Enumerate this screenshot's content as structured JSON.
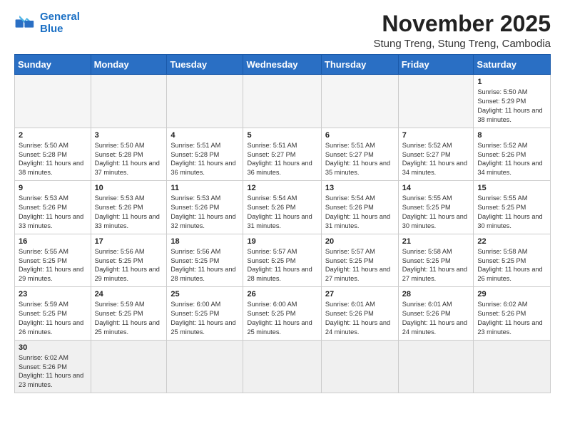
{
  "logo": {
    "general": "General",
    "blue": "Blue"
  },
  "header": {
    "title": "November 2025",
    "subtitle": "Stung Treng, Stung Treng, Cambodia"
  },
  "weekdays": [
    "Sunday",
    "Monday",
    "Tuesday",
    "Wednesday",
    "Thursday",
    "Friday",
    "Saturday"
  ],
  "days": {
    "1": {
      "sunrise": "5:50 AM",
      "sunset": "5:29 PM",
      "daylight": "11 hours and 38 minutes."
    },
    "2": {
      "sunrise": "5:50 AM",
      "sunset": "5:28 PM",
      "daylight": "11 hours and 38 minutes."
    },
    "3": {
      "sunrise": "5:50 AM",
      "sunset": "5:28 PM",
      "daylight": "11 hours and 37 minutes."
    },
    "4": {
      "sunrise": "5:51 AM",
      "sunset": "5:28 PM",
      "daylight": "11 hours and 36 minutes."
    },
    "5": {
      "sunrise": "5:51 AM",
      "sunset": "5:27 PM",
      "daylight": "11 hours and 36 minutes."
    },
    "6": {
      "sunrise": "5:51 AM",
      "sunset": "5:27 PM",
      "daylight": "11 hours and 35 minutes."
    },
    "7": {
      "sunrise": "5:52 AM",
      "sunset": "5:27 PM",
      "daylight": "11 hours and 34 minutes."
    },
    "8": {
      "sunrise": "5:52 AM",
      "sunset": "5:26 PM",
      "daylight": "11 hours and 34 minutes."
    },
    "9": {
      "sunrise": "5:53 AM",
      "sunset": "5:26 PM",
      "daylight": "11 hours and 33 minutes."
    },
    "10": {
      "sunrise": "5:53 AM",
      "sunset": "5:26 PM",
      "daylight": "11 hours and 33 minutes."
    },
    "11": {
      "sunrise": "5:53 AM",
      "sunset": "5:26 PM",
      "daylight": "11 hours and 32 minutes."
    },
    "12": {
      "sunrise": "5:54 AM",
      "sunset": "5:26 PM",
      "daylight": "11 hours and 31 minutes."
    },
    "13": {
      "sunrise": "5:54 AM",
      "sunset": "5:26 PM",
      "daylight": "11 hours and 31 minutes."
    },
    "14": {
      "sunrise": "5:55 AM",
      "sunset": "5:25 PM",
      "daylight": "11 hours and 30 minutes."
    },
    "15": {
      "sunrise": "5:55 AM",
      "sunset": "5:25 PM",
      "daylight": "11 hours and 30 minutes."
    },
    "16": {
      "sunrise": "5:55 AM",
      "sunset": "5:25 PM",
      "daylight": "11 hours and 29 minutes."
    },
    "17": {
      "sunrise": "5:56 AM",
      "sunset": "5:25 PM",
      "daylight": "11 hours and 29 minutes."
    },
    "18": {
      "sunrise": "5:56 AM",
      "sunset": "5:25 PM",
      "daylight": "11 hours and 28 minutes."
    },
    "19": {
      "sunrise": "5:57 AM",
      "sunset": "5:25 PM",
      "daylight": "11 hours and 28 minutes."
    },
    "20": {
      "sunrise": "5:57 AM",
      "sunset": "5:25 PM",
      "daylight": "11 hours and 27 minutes."
    },
    "21": {
      "sunrise": "5:58 AM",
      "sunset": "5:25 PM",
      "daylight": "11 hours and 27 minutes."
    },
    "22": {
      "sunrise": "5:58 AM",
      "sunset": "5:25 PM",
      "daylight": "11 hours and 26 minutes."
    },
    "23": {
      "sunrise": "5:59 AM",
      "sunset": "5:25 PM",
      "daylight": "11 hours and 26 minutes."
    },
    "24": {
      "sunrise": "5:59 AM",
      "sunset": "5:25 PM",
      "daylight": "11 hours and 25 minutes."
    },
    "25": {
      "sunrise": "6:00 AM",
      "sunset": "5:25 PM",
      "daylight": "11 hours and 25 minutes."
    },
    "26": {
      "sunrise": "6:00 AM",
      "sunset": "5:25 PM",
      "daylight": "11 hours and 25 minutes."
    },
    "27": {
      "sunrise": "6:01 AM",
      "sunset": "5:26 PM",
      "daylight": "11 hours and 24 minutes."
    },
    "28": {
      "sunrise": "6:01 AM",
      "sunset": "5:26 PM",
      "daylight": "11 hours and 24 minutes."
    },
    "29": {
      "sunrise": "6:02 AM",
      "sunset": "5:26 PM",
      "daylight": "11 hours and 23 minutes."
    },
    "30": {
      "sunrise": "6:02 AM",
      "sunset": "5:26 PM",
      "daylight": "11 hours and 23 minutes."
    }
  }
}
